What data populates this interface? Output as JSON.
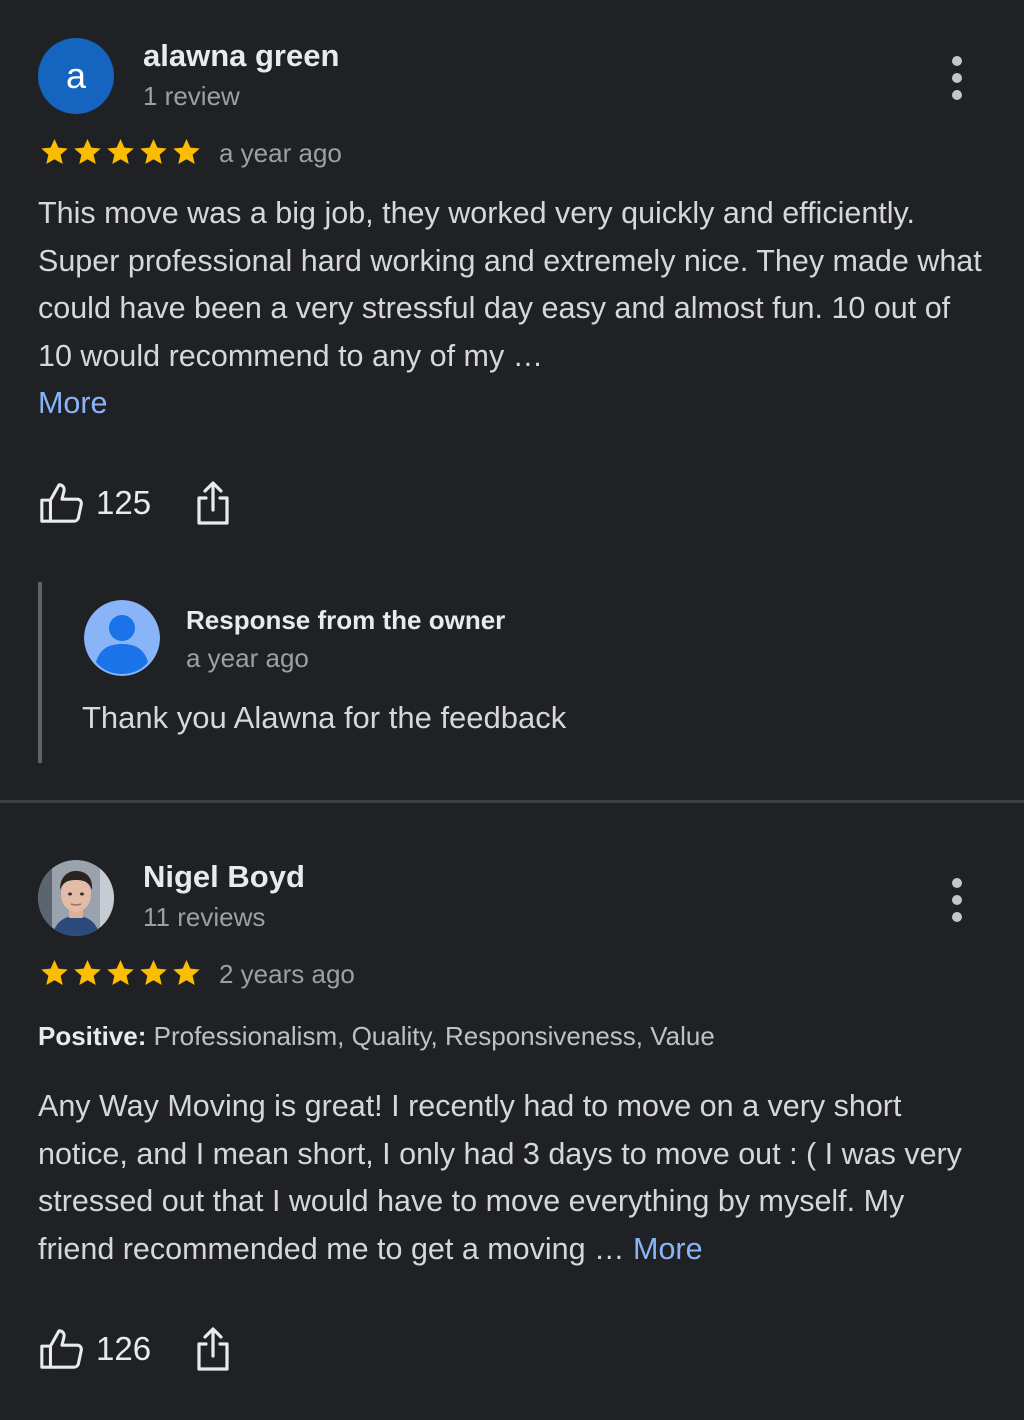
{
  "reviews": [
    {
      "avatar_letter": "a",
      "name": "alawna green",
      "review_count": "1 review",
      "rating": 5,
      "time_ago": "a year ago",
      "text": "This move was a big job, they worked very quickly and efficiently. Super professional hard working and extremely nice. They made what could have been a very stressful day easy and almost fun. 10 out of 10 would recommend to any of my …",
      "more_label": "More",
      "likes": "125",
      "owner_response": {
        "title": "Response from the owner",
        "time_ago": "a year ago",
        "text": "Thank you Alawna for the feedback"
      }
    },
    {
      "name": "Nigel Boyd",
      "review_count": "11 reviews",
      "rating": 5,
      "time_ago": "2 years ago",
      "attributes_label": "Positive:",
      "attributes": "Professionalism, Quality, Responsiveness, Value",
      "text": "Any Way Moving is great! I recently had to move on a very short notice, and I mean short, I only had 3 days to move out : ( I was very stressed out that I would have to move everything by myself. My friend recommended me to get a moving … ",
      "more_label": "More",
      "likes": "126"
    }
  ],
  "colors": {
    "background": "#202124",
    "star": "#fbbc04",
    "link": "#8ab4f8",
    "avatar_blue": "#1565c0",
    "owner_avatar_bg": "#8ab4f8",
    "owner_avatar_fg": "#1a73e8"
  },
  "icons": {
    "like": "thumb-up-icon",
    "share": "share-icon",
    "menu": "more-vert-icon",
    "star": "star-icon"
  }
}
